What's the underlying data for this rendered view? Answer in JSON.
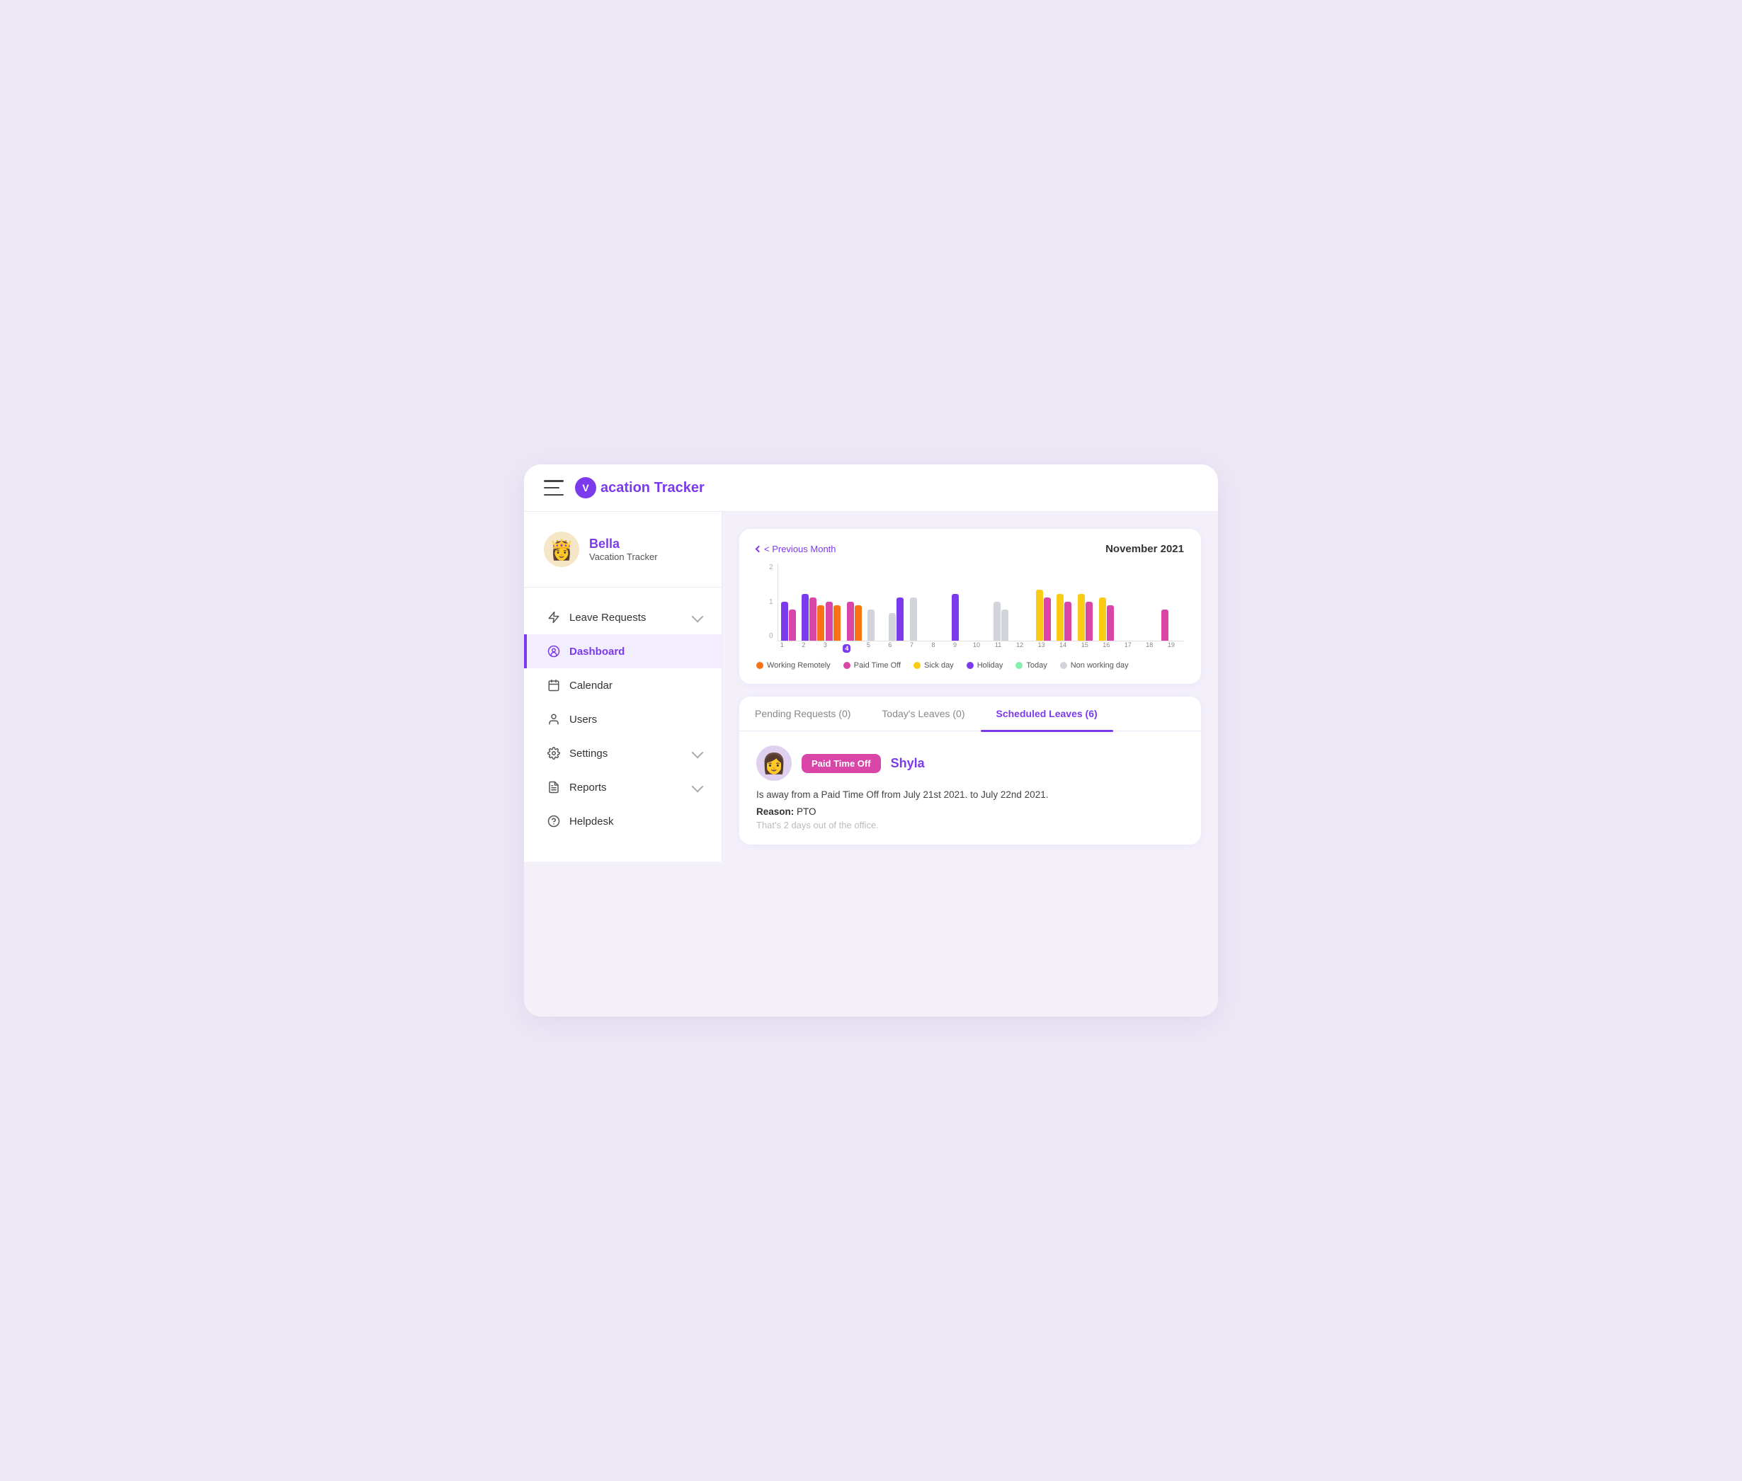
{
  "topbar": {
    "logo_letter": "V",
    "logo_text": "acation Tracker"
  },
  "sidebar": {
    "user": {
      "name": "Bella",
      "subtitle": "Vacation Tracker",
      "avatar_emoji": "👸"
    },
    "nav_items": [
      {
        "id": "leave-requests",
        "label": "Leave Requests",
        "icon": "bolt",
        "has_chevron": true,
        "active": false
      },
      {
        "id": "dashboard",
        "label": "Dashboard",
        "icon": "dashboard",
        "has_chevron": false,
        "active": true
      },
      {
        "id": "calendar",
        "label": "Calendar",
        "icon": "calendar",
        "has_chevron": false,
        "active": false
      },
      {
        "id": "users",
        "label": "Users",
        "icon": "user",
        "has_chevron": false,
        "active": false
      },
      {
        "id": "settings",
        "label": "Settings",
        "icon": "gear",
        "has_chevron": true,
        "active": false
      },
      {
        "id": "reports",
        "label": "Reports",
        "icon": "report",
        "has_chevron": true,
        "active": false
      },
      {
        "id": "helpdesk",
        "label": "Helpdesk",
        "icon": "help",
        "has_chevron": false,
        "active": false
      }
    ]
  },
  "chart": {
    "prev_month_label": "< Previous Month",
    "month_title": "November 2021",
    "y_labels": [
      "0",
      "1",
      "2"
    ],
    "x_labels": [
      "1",
      "2",
      "3",
      "4",
      "5",
      "6",
      "7",
      "8",
      "9",
      "10",
      "11",
      "12",
      "13",
      "14",
      "15",
      "16",
      "17",
      "18",
      "19"
    ],
    "today_index": 3,
    "legend": [
      {
        "label": "Working Remotely",
        "color": "#f97316"
      },
      {
        "label": "Paid Time Off",
        "color": "#d946a8"
      },
      {
        "label": "Sick day",
        "color": "#facc15"
      },
      {
        "label": "Holiday",
        "color": "#7c3aed"
      },
      {
        "label": "Today",
        "color": "#86efac"
      },
      {
        "label": "Non working day",
        "color": "#d1d5db"
      }
    ],
    "bars": [
      [
        {
          "color": "#7c3aed",
          "height": 50
        },
        {
          "color": "#d946a8",
          "height": 40
        }
      ],
      [
        {
          "color": "#7c3aed",
          "height": 60
        },
        {
          "color": "#d946a8",
          "height": 55
        },
        {
          "color": "#f97316",
          "height": 45
        }
      ],
      [
        {
          "color": "#d946a8",
          "height": 50
        },
        {
          "color": "#f97316",
          "height": 45
        }
      ],
      [
        {
          "color": "#d946a8",
          "height": 50
        },
        {
          "color": "#f97316",
          "height": 45
        }
      ],
      [
        {
          "color": "#d1d5db",
          "height": 40
        }
      ],
      [
        {
          "color": "#d1d5db",
          "height": 35
        },
        {
          "color": "#7c3aed",
          "height": 55
        }
      ],
      [
        {
          "color": "#d1d5db",
          "height": 55
        }
      ],
      [],
      [
        {
          "color": "#7c3aed",
          "height": 60
        }
      ],
      [],
      [
        {
          "color": "#d1d5db",
          "height": 50
        },
        {
          "color": "#d1d5db",
          "height": 40
        }
      ],
      [],
      [
        {
          "color": "#facc15",
          "height": 65
        },
        {
          "color": "#d946a8",
          "height": 55
        }
      ],
      [
        {
          "color": "#facc15",
          "height": 60
        },
        {
          "color": "#d946a8",
          "height": 50
        }
      ],
      [
        {
          "color": "#facc15",
          "height": 60
        },
        {
          "color": "#d946a8",
          "height": 50
        }
      ],
      [
        {
          "color": "#facc15",
          "height": 55
        },
        {
          "color": "#d946a8",
          "height": 45
        }
      ],
      [],
      [],
      [
        {
          "color": "#d946a8",
          "height": 40
        }
      ]
    ]
  },
  "tabs": {
    "items": [
      {
        "id": "pending",
        "label": "Pending Requests (0)",
        "active": false
      },
      {
        "id": "today",
        "label": "Today's Leaves (0)",
        "active": false
      },
      {
        "id": "scheduled",
        "label": "Scheduled Leaves (6)",
        "active": true
      }
    ]
  },
  "leave_entry": {
    "badge_label": "Paid Time Off",
    "user_name": "Shyla",
    "avatar_emoji": "👩",
    "description": "Is away from a Paid Time Off from July 21st 2021. to July 22nd 2021.",
    "reason_label": "Reason:",
    "reason_value": "PTO",
    "note": "That's 2 days out of the office."
  }
}
